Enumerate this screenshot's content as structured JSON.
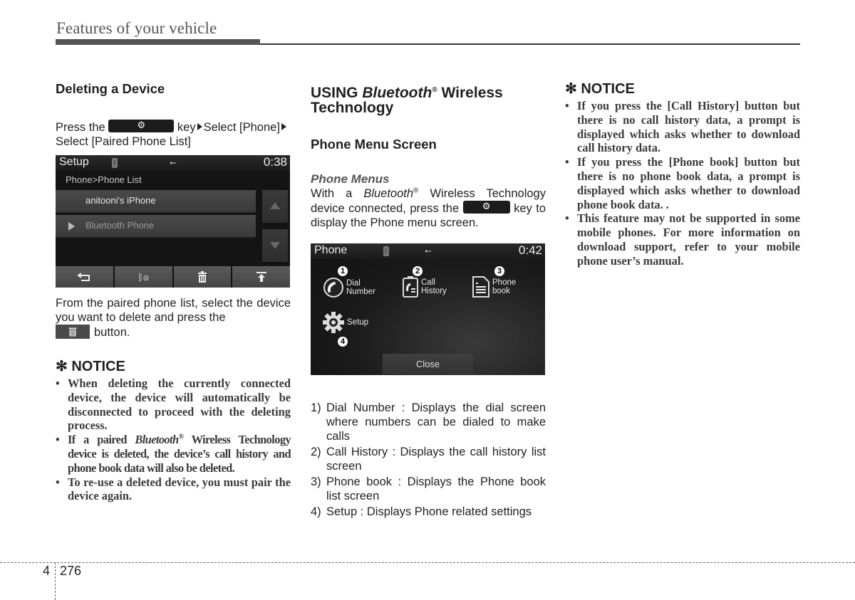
{
  "header": {
    "title": "Features of your vehicle"
  },
  "col1": {
    "heading": "Deleting a Device",
    "instr_pre": "Press the",
    "instr_key": "key",
    "instr_step1": "Select [Phone]",
    "instr_step2": "Select [Paired Phone List]",
    "screen": {
      "title": "Setup",
      "time": "0:38",
      "breadcrumb": "Phone>Phone List",
      "devices": [
        {
          "name": "anitooni's iPhone",
          "selected": false
        },
        {
          "name": "Bluetooth Phone",
          "selected": true
        }
      ],
      "bottom_buttons": [
        {
          "icon": "back-icon",
          "glyph": "⮌"
        },
        {
          "icon": "bluetooth-disconnect-icon",
          "glyph": "✱⊗"
        },
        {
          "icon": "trash-icon",
          "glyph": "🗑"
        },
        {
          "icon": "move-top-icon",
          "glyph": "⤒"
        }
      ]
    },
    "para_pre": "From the paired phone list, select the device you want to delete and press the",
    "para_post": "button.",
    "notice": {
      "title": "✻ NOTICE",
      "items": [
        "When deleting the currently connected device, the device will automatically be disconnected to proceed with the deleting process.",
        {
          "pre": "If a paired ",
          "italic": "Bluetooth",
          "reg": "®",
          "post": " Wireless Technology device is deleted, the device’s call history and phone book data will also be deleted."
        },
        "To re-use a deleted device, you must pair the device again."
      ]
    }
  },
  "col2": {
    "heading_pre": "USING ",
    "heading_italic": "Bluetooth",
    "heading_reg": "®",
    "heading_post": " Wireless Technology",
    "subheading": "Phone Menu Screen",
    "subsub": "Phone Menus",
    "para_a": "With a ",
    "para_italic": "Bluetooth",
    "para_reg": "®",
    "para_b": " Wireless Technology device connected, press the",
    "para_c": "key to display the Phone menu screen.",
    "screen": {
      "title": "Phone",
      "time": "0:42",
      "items": [
        {
          "num": "1",
          "label1": "Dial",
          "label2": "Number"
        },
        {
          "num": "2",
          "label1": "Call",
          "label2": "History"
        },
        {
          "num": "3",
          "label1": "Phone",
          "label2": "book"
        },
        {
          "num": "4",
          "label1": "Setup",
          "label2": ""
        }
      ],
      "close": "Close"
    },
    "list": [
      {
        "n": "1)",
        "text": "Dial Number : Displays the dial screen where numbers can be dialed to make calls"
      },
      {
        "n": "2)",
        "text": "Call History : Displays the call history list screen"
      },
      {
        "n": "3)",
        "text": "Phone book : Displays the Phone book list screen"
      },
      {
        "n": "4)",
        "text": "Setup : Displays Phone related settings"
      }
    ]
  },
  "col3": {
    "notice": {
      "title": "✻ NOTICE",
      "items": [
        "If you press the [Call History] button but there is no call history data, a prompt is displayed which asks whether to download call history data.",
        "If you press the [Phone book] button but there is no phone book data, a prompt is displayed which asks whether to download phone book data. .",
        "This feature may not be supported in some mobile phones. For more information on download support, refer to your mobile phone user’s manual."
      ]
    }
  },
  "footer": {
    "chapter": "4",
    "page": "276"
  }
}
